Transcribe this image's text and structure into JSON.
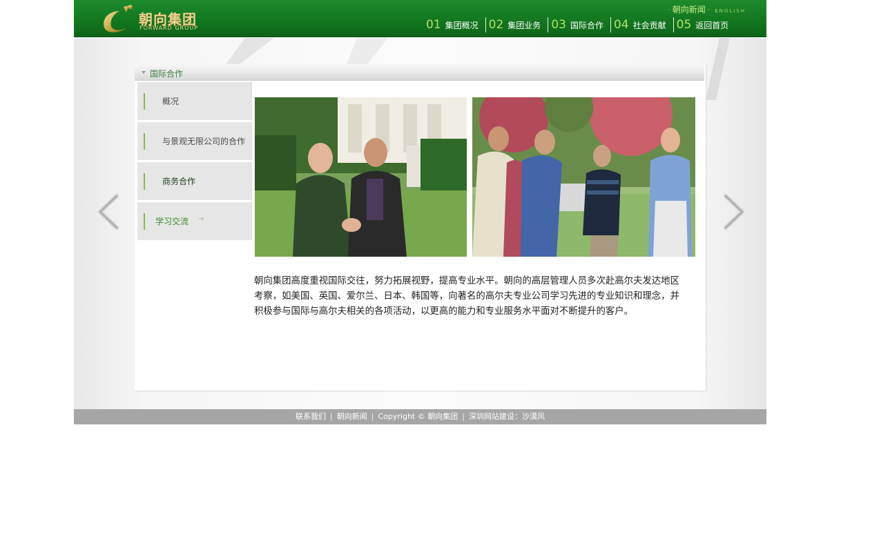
{
  "header": {
    "logo_cn": "朝向集团",
    "logo_en": "FORWARD GROUP",
    "toplinks": {
      "news": "朝向新闻",
      "english": "ENGLISH"
    },
    "nav": [
      {
        "num": "01",
        "label": "集团概况"
      },
      {
        "num": "02",
        "label": "集团业务"
      },
      {
        "num": "03",
        "label": "国际合作"
      },
      {
        "num": "04",
        "label": "社会贡献"
      },
      {
        "num": "05",
        "label": "返回首页"
      }
    ]
  },
  "panel": {
    "title": "国际合作",
    "side_menu": [
      {
        "label": "概况"
      },
      {
        "label": "与景观无限公司的合作"
      },
      {
        "label": "商务合作"
      },
      {
        "label": "学习交流"
      }
    ],
    "description": "朝向集团高度重视国际交往，努力拓展视野，提高专业水平。朝向的高层管理人员多次赴高尔夫发达地区考察，如美国、英国、爱尔兰、日本、韩国等，向著名的高尔夫专业公司学习先进的专业知识和理念，并积极参与国际与高尔夫相关的各项活动，以更高的能力和专业服务水平面对不断提升的客户。"
  },
  "footer": {
    "links": [
      "联系我们",
      "朝向新闻",
      "Copyright © 朝向集团",
      "深圳网站建设：沙漠风"
    ]
  },
  "icons": {
    "prev": "chevron-left-icon",
    "next": "chevron-right-icon",
    "submenu_arrow": "arrow-right-icon"
  },
  "colors": {
    "header_green": "#13781f",
    "nav_number": "#b3e06a",
    "accent_bar": "#7fc043",
    "footer_gray": "#a6a6a6"
  }
}
